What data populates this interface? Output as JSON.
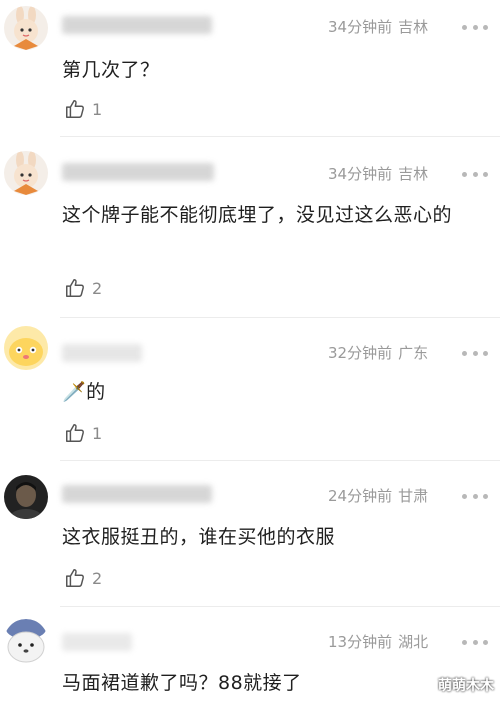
{
  "comments": [
    {
      "time": "34分钟前",
      "location": "吉林",
      "text": "第几次了？",
      "likes": "1",
      "avatar": "cartoon-rabbit-icon"
    },
    {
      "time": "34分钟前",
      "location": "吉林",
      "text": "这个牌子能不能彻底埋了，没见过这么恶心的",
      "likes": "2",
      "avatar": "cartoon-rabbit-icon"
    },
    {
      "time": "32分钟前",
      "location": "广东",
      "text": "🗡️的",
      "likes": "1",
      "avatar": "cartoon-blob-icon"
    },
    {
      "time": "24分钟前",
      "location": "甘肃",
      "text": "这衣服挺丑的，谁在买他的衣服",
      "likes": "2",
      "avatar": "photo-face-icon"
    },
    {
      "time": "13分钟前",
      "location": "湖北",
      "text": "马面裙道歉了吗？88就接了",
      "likes": "",
      "avatar": "cartoon-seal-icon"
    }
  ],
  "watermark": "萌萌木木",
  "colors": {
    "meta": "#9a9a9a",
    "text": "#1f1f1f",
    "divider": "#ececec"
  }
}
